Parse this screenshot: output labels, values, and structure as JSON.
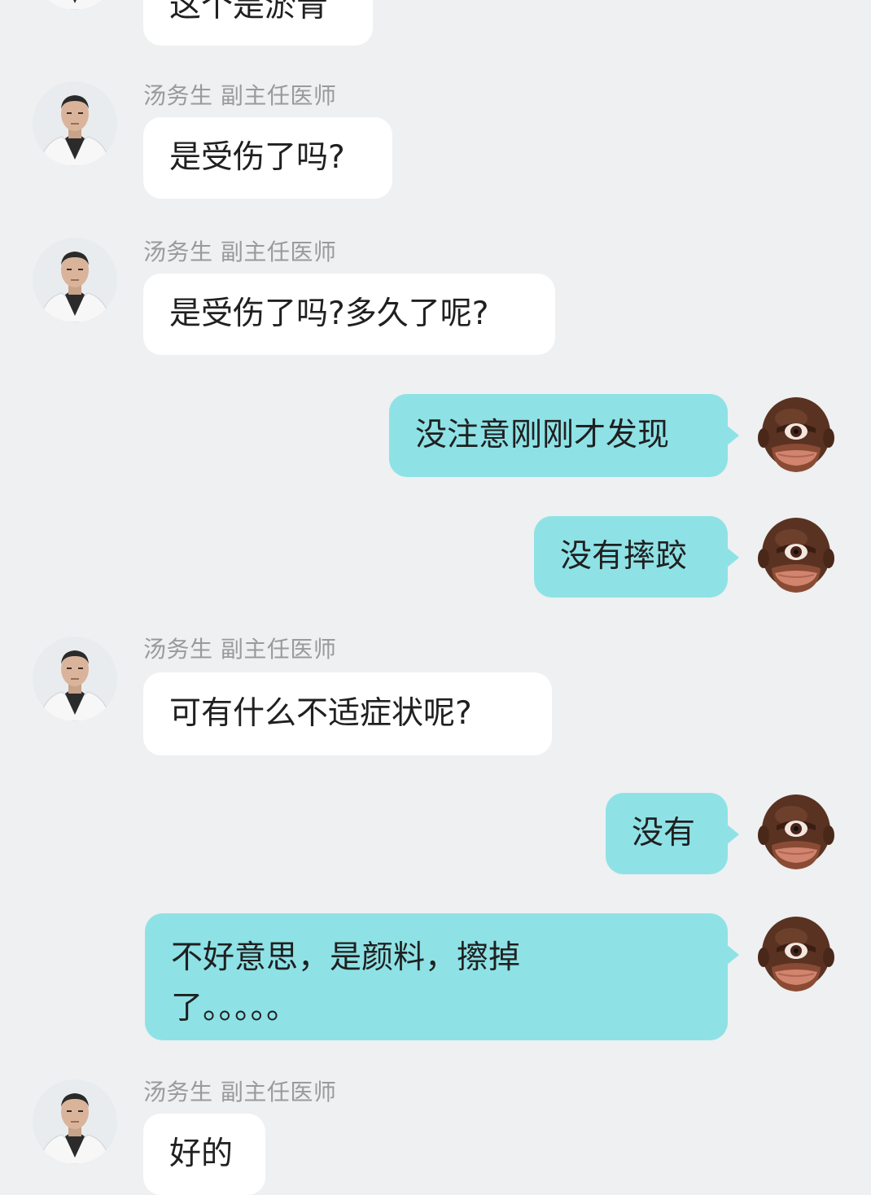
{
  "messages": [
    {
      "side": "left",
      "text": "这个是淤青"
    },
    {
      "side": "left",
      "sender": "汤务生 副主任医师",
      "text": "是受伤了吗?"
    },
    {
      "side": "left",
      "sender": "汤务生 副主任医师",
      "text": "是受伤了吗?多久了呢?"
    },
    {
      "side": "right",
      "text": "没注意刚刚才发现"
    },
    {
      "side": "right",
      "text": "没有摔跤"
    },
    {
      "side": "left",
      "sender": "汤务生 副主任医师",
      "text": "可有什么不适症状呢?"
    },
    {
      "side": "right",
      "text": "没有"
    },
    {
      "side": "right",
      "lines": [
        "不好意思，是颜料，擦掉",
        "了。。。。。"
      ]
    },
    {
      "side": "left",
      "sender": "汤务生 副主任医师",
      "text": "好的"
    }
  ],
  "icons": {
    "doctor_avatar": "doctor-avatar-icon",
    "user_avatar": "cartoon-face-avatar-icon"
  },
  "colors": {
    "background": "#eef0f1",
    "left_bubble": "#ffffff",
    "right_bubble": "#8ee2e6",
    "sender_text": "#9a9a9a"
  }
}
